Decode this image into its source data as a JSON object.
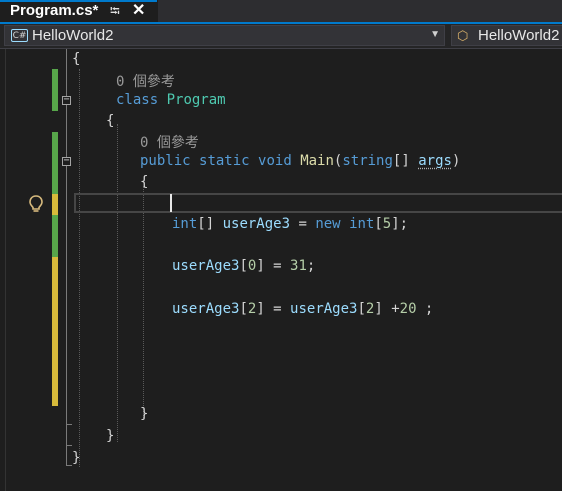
{
  "tab": {
    "title": "Program.cs*",
    "pin_icon": "pin-icon",
    "close_icon": "close-icon"
  },
  "navbar": {
    "project_badge": "C#",
    "project": "HelloWorld2",
    "class_scope": "HelloWorld2"
  },
  "colors": {
    "keyword": "#569cd6",
    "type": "#4ec9b0",
    "method": "#dcdcaa",
    "identifier": "#9cdcfe",
    "number": "#b5cea8",
    "plain": "#d4d4d4",
    "codelens": "#999999",
    "change_saved": "#57a64a",
    "change_unsaved": "#d7ba3b",
    "accent": "#007acc"
  },
  "code": {
    "l1": "{",
    "lens_class": "0 個參考",
    "class_kw": "class",
    "class_name": "Program",
    "l3": "{",
    "lens_main": "0 個參考",
    "public": "public",
    "static": "static",
    "void": "void",
    "main": "Main",
    "paren_open": "(",
    "string": "string",
    "brackets": "[]",
    "args": "args",
    "paren_close": ")",
    "l5": "{",
    "int1": "int",
    "decl_rest1": "[] ",
    "userAge3": "userAge3",
    "eq": " = ",
    "new": "new",
    "int2": "int",
    "arr_open": "[",
    "five": "5",
    "arr_close": "];",
    "assign_a_open": "[",
    "zero": "0",
    "assign_a_mid": "] = ",
    "thirtyone": "31",
    "semi": ";",
    "two": "2",
    "plus": " +",
    "twenty": "20",
    "tail": " ;",
    "close_main": "}",
    "close_class": "}",
    "close_ns": "}"
  }
}
